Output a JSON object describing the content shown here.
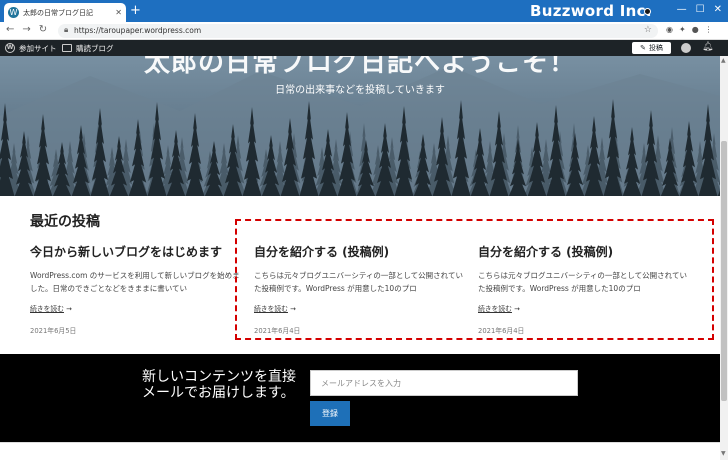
{
  "browser": {
    "tab_title": "太郎の日常ブログ日記",
    "tab_close": "✕",
    "new_tab": "+",
    "brand": "Buzzword Inc.",
    "url": "https://taroupaper.wordpress.com",
    "window_controls": [
      "—",
      "☐",
      "✕"
    ]
  },
  "adminbar": {
    "site_label": "参加サイト",
    "reader_label": "購読ブログ",
    "post_label": "投稿"
  },
  "hero": {
    "title": "太郎の日常ブログ日記へようこそ！",
    "tagline": "日常の出来事などを投稿していきます"
  },
  "recent": {
    "heading": "最近の投稿",
    "posts": [
      {
        "title": "今日から新しいブログをはじめます",
        "excerpt": "WordPress.com のサービスを利用して新しいブログを始めました。日常のできごとなどをきままに書いてい",
        "more": "続きを読む",
        "date": "2021年6月5日"
      },
      {
        "title": "自分を紹介する (投稿例)",
        "excerpt": "こちらは元々ブログユニバーシティの一部として公開されていた投稿例です。WordPress が用意した10のプロ",
        "more": "続きを読む",
        "date": "2021年6月4日"
      },
      {
        "title": "自分を紹介する (投稿例)",
        "excerpt": "こちらは元々ブログユニバーシティの一部として公開されていた投稿例です。WordPress が用意した10のプロ",
        "more": "続きを読む",
        "date": "2021年6月4日"
      }
    ]
  },
  "subscribe": {
    "text": "新しいコンテンツを直接メールでお届けします。",
    "placeholder": "メールアドレスを入力",
    "button": "登録"
  },
  "colors": {
    "titlebar": "#1e6fc0",
    "adminbar": "#1d2327",
    "highlight": "#d40000",
    "button": "#1e70b8"
  }
}
